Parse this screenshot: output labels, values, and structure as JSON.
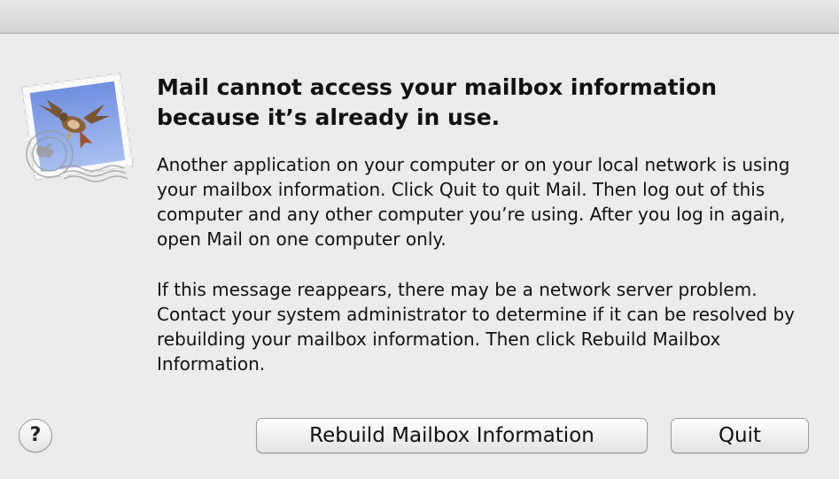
{
  "dialog": {
    "app_icon": "mail-stamp-icon",
    "title": "Mail cannot access your mailbox information because it’s already in use.",
    "message_paragraph_1": "Another application on your computer or on your local network is using your mailbox information. Click Quit to quit Mail. Then log out of this computer and any other computer you’re using. After you log in again, open Mail on one computer only.",
    "message_paragraph_2": "If this message reappears, there may be a network server problem. Contact your system administrator to determine if it can be resolved by rebuilding your mailbox information. Then click Rebuild Mailbox Information.",
    "help_label": "?",
    "rebuild_label": "Rebuild Mailbox Information",
    "quit_label": "Quit"
  }
}
